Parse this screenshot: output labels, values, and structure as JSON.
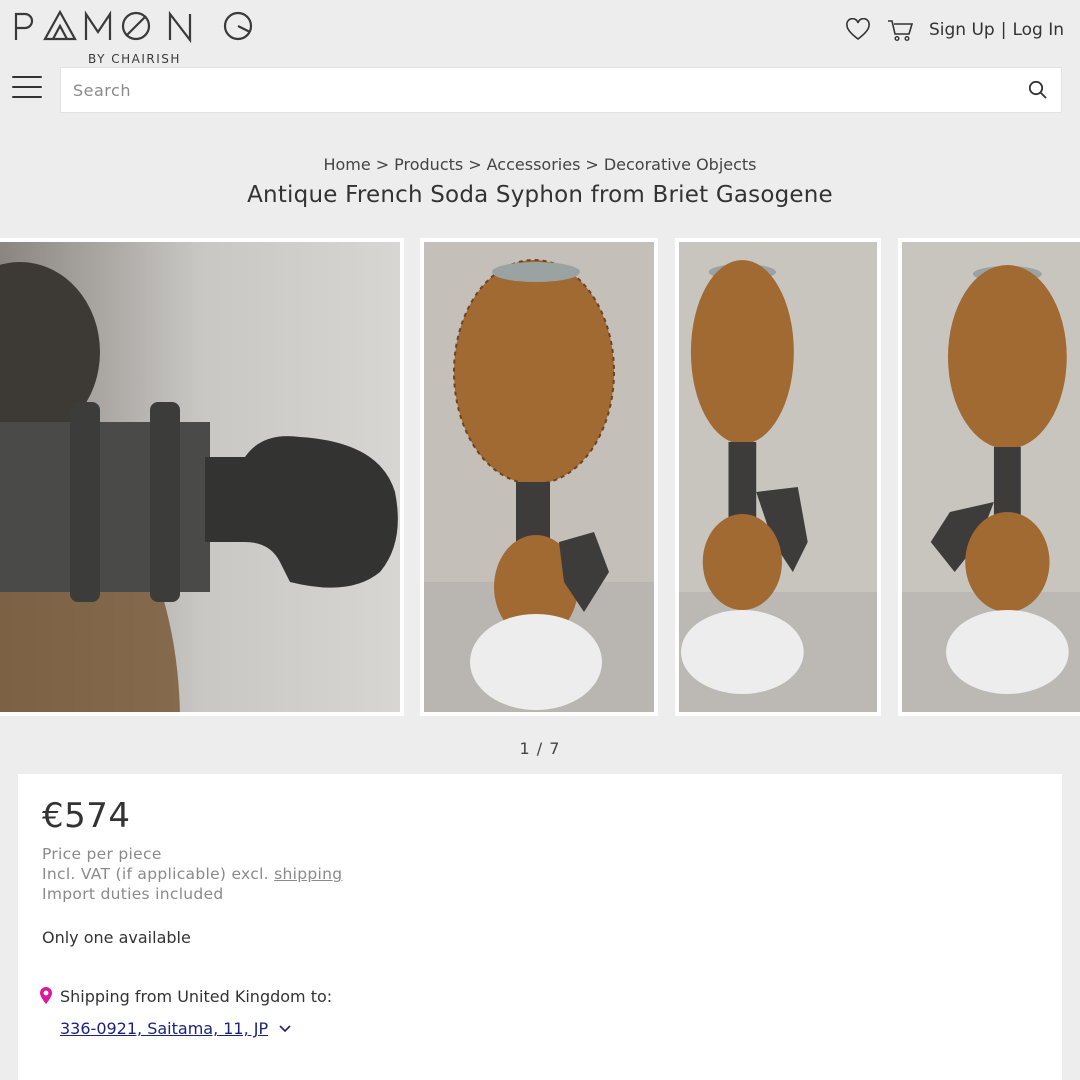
{
  "header": {
    "brand": "PAMONO",
    "brand_sub": "BY CHAIRISH",
    "icons": [
      "heart-icon",
      "cart-icon"
    ],
    "sign_up": "Sign Up",
    "separator": "|",
    "log_in": "Log In"
  },
  "search": {
    "placeholder": "Search",
    "value": ""
  },
  "breadcrumb": [
    "Home",
    "Products",
    "Accessories",
    "Decorative Objects"
  ],
  "breadcrumb_sep": ">",
  "product": {
    "title": "Antique French Soda Syphon from Briet Gasogene",
    "pager": "1 / 7",
    "price": "€574",
    "price_per": "Price per piece",
    "vat_prefix": "Incl. VAT (if applicable) excl.",
    "vat_link": "shipping",
    "duties": "Import duties included",
    "availability": "Only one available",
    "shipping_label": "Shipping from United Kingdom to:",
    "destination": "336-0921, Saitama, 11, JP"
  },
  "colors": {
    "accent_pin": "#d81b9c",
    "link": "#1a237e",
    "background": "#ededed"
  }
}
